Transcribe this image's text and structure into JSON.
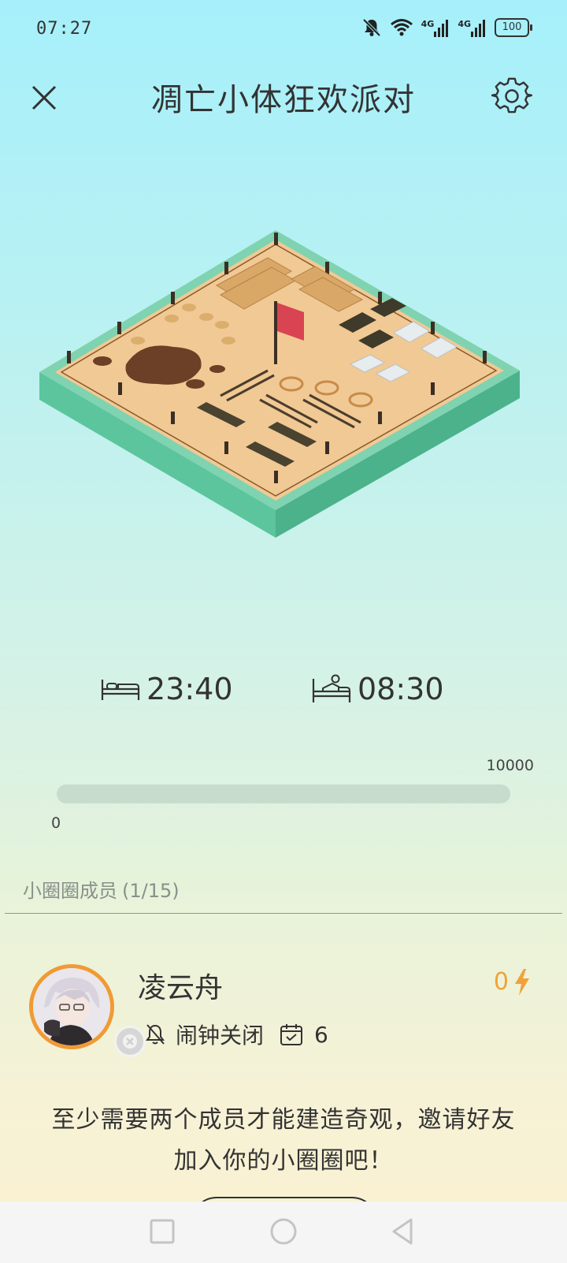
{
  "status_bar": {
    "time": "07:27",
    "network_1": "4G",
    "network_2": "4G",
    "battery": "100"
  },
  "header": {
    "title": "凋亡小体狂欢派对"
  },
  "alarm": {
    "sleep_time": "23:40",
    "wake_time": "08:30"
  },
  "progress": {
    "min_label": "0",
    "max_label": "10000",
    "fraction": 0
  },
  "members": {
    "title": "小圈圈成员",
    "count": "(1/15)",
    "list": [
      {
        "name": "凌云舟",
        "alarm_status": "闹钟关闭",
        "days": "6",
        "energy": "0"
      }
    ]
  },
  "invite": {
    "line1": "至少需要两个成员才能建造奇观，邀请好友",
    "line2": "加入你的小圈圈吧！"
  },
  "colors": {
    "accent_orange": "#f0a23a",
    "avatar_ring": "#f19a34",
    "progress_track": "#c8dccd"
  }
}
